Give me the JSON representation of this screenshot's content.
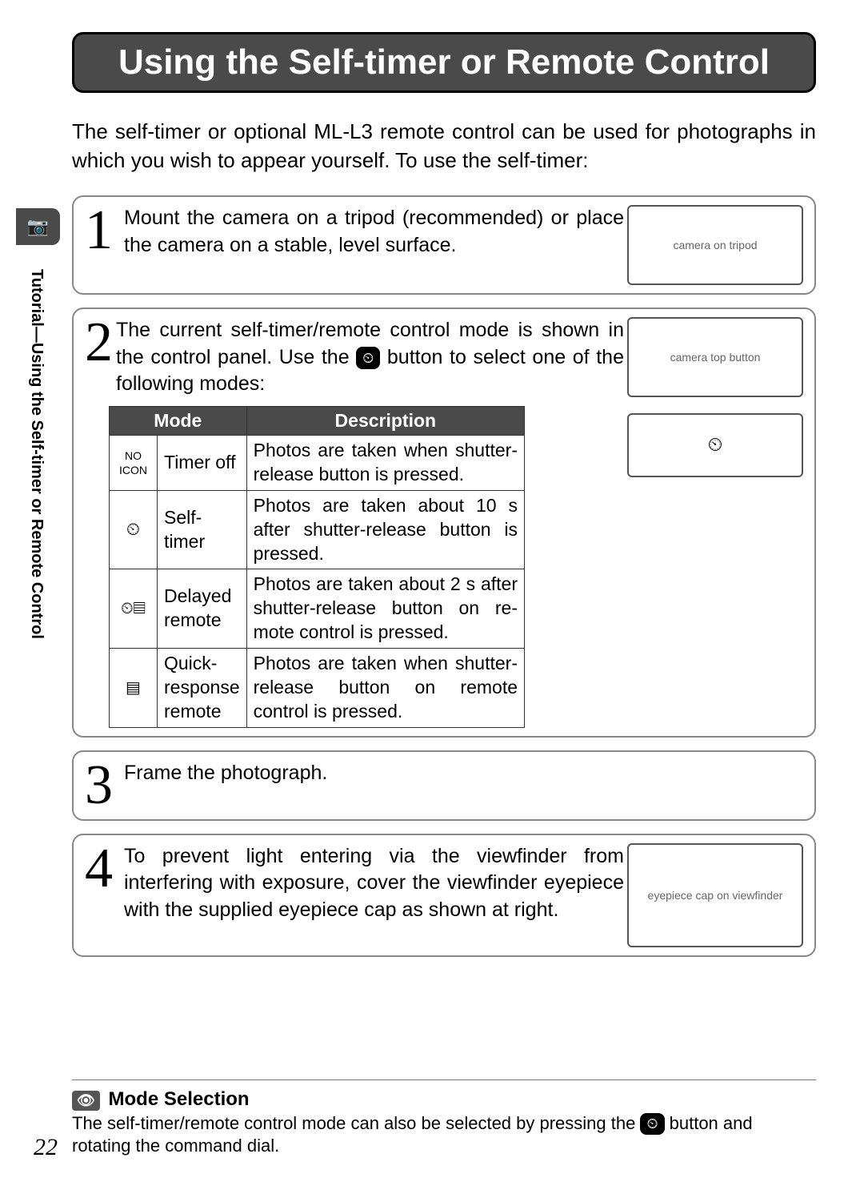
{
  "title": "Using the Self-timer or Remote Control",
  "intro": "The self-timer or optional ML-L3 remote control can be used for photo­graphs in which you wish to appear yourself.  To use the self-timer:",
  "side_label": "Tutorial—Using the Self-timer or Remote Control",
  "steps": {
    "s1": {
      "num": "1",
      "text": "Mount the camera on a tripod (recommend­ed) or place the camera on a stable, level surface.",
      "illo_alt": "camera on tripod"
    },
    "s2": {
      "num": "2",
      "text_a": "The current self-timer/remote control mode is shown in the control panel.  Use the ",
      "text_b": " button to select one of the following modes:",
      "illo_top_alt": "camera top button",
      "illo_lcd": "⏲"
    },
    "s3": {
      "num": "3",
      "text": "Frame the photograph."
    },
    "s4": {
      "num": "4",
      "text": "To prevent light entering via the viewfinder from interfering with exposure, cover the viewfinder eyepiece with the supplied eye­piece cap as shown at right.",
      "illo_alt": "eyepiece cap on viewfinder"
    }
  },
  "table": {
    "headers": {
      "mode": "Mode",
      "desc": "Description"
    },
    "rows": [
      {
        "icon": "NO ICON",
        "mode": "Timer off",
        "desc": "Photos are taken when shutter-release button is pressed."
      },
      {
        "icon": "⏲",
        "mode": "Self-timer",
        "desc": "Photos are taken about 10 s after shutter-release button is pressed."
      },
      {
        "icon": "⏲▤",
        "mode": "Delayed remote",
        "desc": "Photos are taken about 2 s after shutter-release button on re­mote control is pressed."
      },
      {
        "icon": "▤",
        "mode": "Quick-response remote",
        "desc": "Photos are taken when shut­ter-release button on remote control is pressed."
      }
    ]
  },
  "tip": {
    "title": "Mode Selection",
    "text_a": "The self-timer/remote control mode can also be selected by pressing the ",
    "text_b": " button and rotating the command dial."
  },
  "icons": {
    "timer_btn": "⏲",
    "camera_tab": "📷"
  },
  "page_number": "22"
}
